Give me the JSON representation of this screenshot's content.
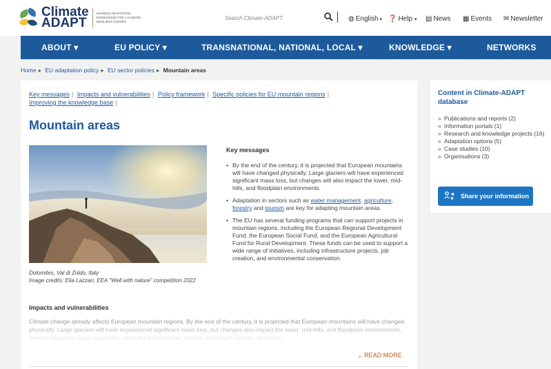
{
  "header": {
    "logo_line1": "Climate",
    "logo_line2": "ADAPT",
    "logo_tagline": "SHARING ADAPTATION KNOWLEDGE FOR A CLIMATE-RESILIENT EUROPE",
    "search_placeholder": "Search Climate-ADAPT",
    "language": "English",
    "help": "Help",
    "news": "News",
    "events": "Events",
    "newsletter": "Newsletter"
  },
  "nav": {
    "items": [
      {
        "label": "ABOUT"
      },
      {
        "label": "EU POLICY"
      },
      {
        "label": "TRANSNATIONAL, NATIONAL, LOCAL"
      },
      {
        "label": "KNOWLEDGE"
      },
      {
        "label": "NETWORKS"
      }
    ]
  },
  "breadcrumb": [
    "Home",
    "EU adaptation policy",
    "EU sector policies",
    "Mountain areas"
  ],
  "anchors": [
    "Key messages",
    "Impacts and vulnerabilities",
    "Policy framework",
    "Specific policies for EU mountain regions",
    "Improving the knowledge base"
  ],
  "page_title": "Mountain areas",
  "photo": {
    "caption_line1": "Dolomites, Val di Zoldo, Italy",
    "caption_line2": "Image credits: Elia Lazzari, EEA \"Well with nature\" competition 2022"
  },
  "key_messages": {
    "title": "Key messages",
    "item1": "By the end of the century, it is projected that European mountains will have changed physically. Large glaciers will have experienced significant mass loss, but changes will also impact the lower, mid-hills, and floodplain environments.",
    "item2_prefix": "Adaptation in sectors such as ",
    "item2_link1": "water management",
    "item2_comma1": ", ",
    "item2_link2": "agriculture",
    "item2_comma2": ", ",
    "item2_link3": "forestry",
    "item2_and": " and ",
    "item2_link4": "tourism",
    "item2_suffix": " are key for adapting mountain areas.",
    "item3": "The EU has several funding programs that can support projects in mountain regions, including the European Regional Development Fund, the European Social Fund, and the European Agricultural Fund for Rural Development. These funds can be used to support a wide range of initiatives, including infrastructure projects, job creation, and environmental conservation."
  },
  "impacts": {
    "title": "Impacts and vulnerabilities",
    "text": "Climate change already affects European mountain regions. By the end of the century, it is projected that European mountains will have changed physically. Large glaciers will have experienced significant mass loss, but changes also impact the lower, mid-hills, and floodplain environments, thereby impacting water availability, agricultural production, tourism, and health sectors. Mountain",
    "read_more": "READ MORE"
  },
  "sidebar": {
    "title": "Content in Climate-ADAPT database",
    "items": [
      {
        "label": "Publications and reports (2)"
      },
      {
        "label": "Information portals (1)"
      },
      {
        "label": "Research and knowledge projects (16)"
      },
      {
        "label": "Adaptation options (5)"
      },
      {
        "label": "Case studies (10)"
      },
      {
        "label": "Organisations (3)"
      }
    ],
    "share_button": "Share your information"
  },
  "colors": {
    "brand_blue": "#1d5a9c",
    "button_blue": "#1d76c4",
    "read_more_orange": "#c05a1a"
  }
}
